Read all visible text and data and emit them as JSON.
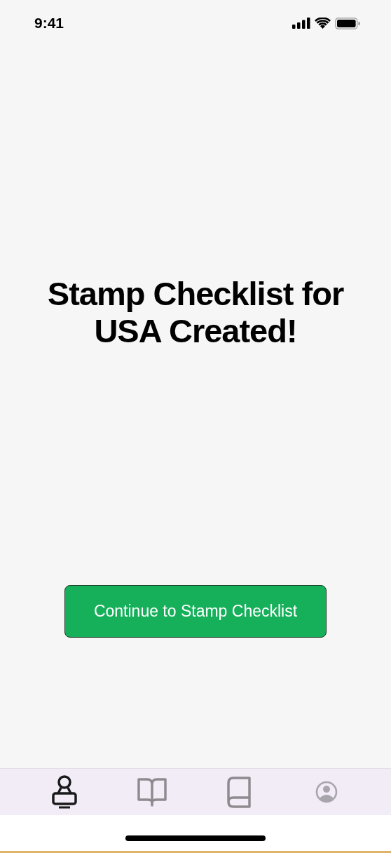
{
  "status_bar": {
    "time": "9:41"
  },
  "title": "Stamp Checklist for USA Created!",
  "button": {
    "label": "Continue to Stamp Checklist"
  },
  "tabs": [
    {
      "kind": "stamp",
      "selected": true
    },
    {
      "kind": "open-book",
      "selected": false
    },
    {
      "kind": "book",
      "selected": false
    },
    {
      "kind": "profile",
      "selected": false
    }
  ]
}
